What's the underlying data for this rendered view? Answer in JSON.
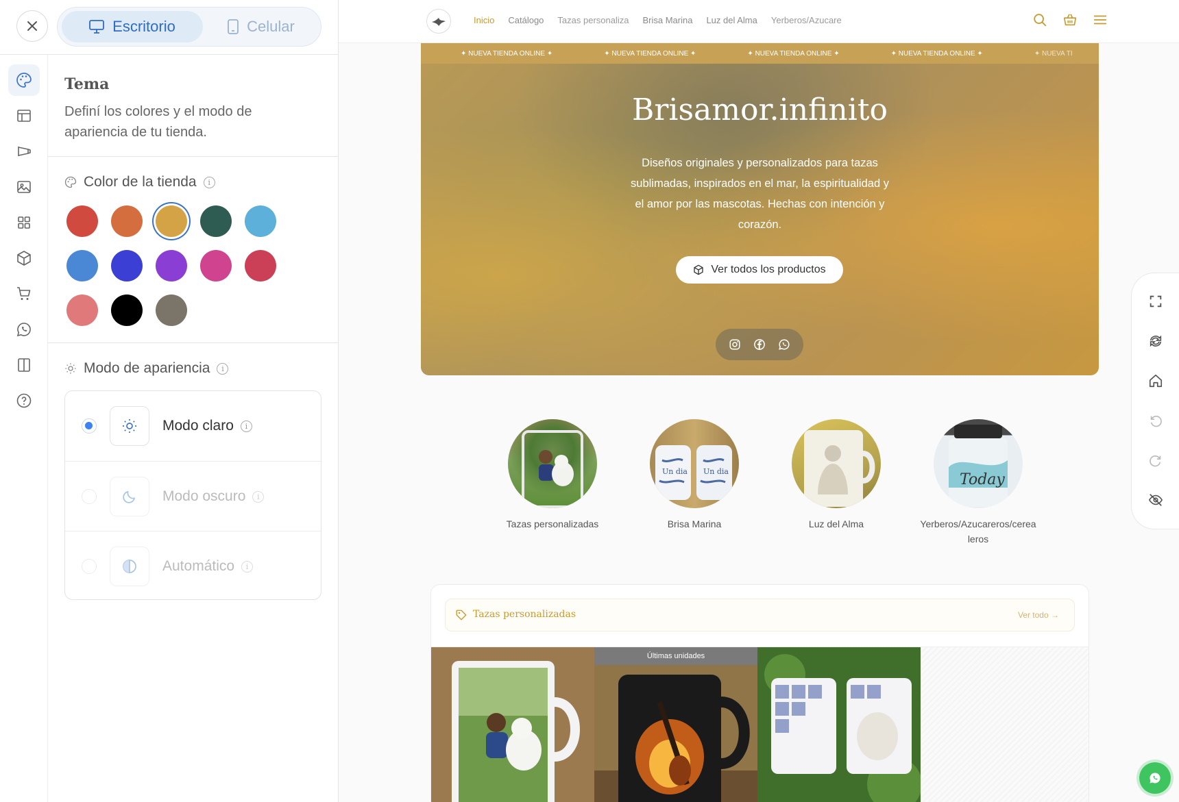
{
  "editor": {
    "view_toggle": {
      "desktop_label": "Escritorio",
      "mobile_label": "Celular",
      "active": "desktop"
    },
    "rail_icons": [
      "palette-icon",
      "layout-icon",
      "megaphone-icon",
      "image-icon",
      "grid-icon",
      "box-icon",
      "cart-icon",
      "whatsapp-icon",
      "columns-icon",
      "help-icon"
    ],
    "theme": {
      "title": "Tema",
      "description": "Definí los colores y el modo de apariencia de tu tienda."
    },
    "store_color": {
      "label": "Color de la tienda",
      "swatches": [
        "#d14a3f",
        "#d56e3e",
        "#d4a346",
        "#2f5c52",
        "#5cb0d9",
        "#4a88d6",
        "#3b3fd4",
        "#8a3ed4",
        "#d0448f",
        "#cc4057",
        "#e07a7a",
        "#000000",
        "#7b7468"
      ],
      "selected": "#d4a346"
    },
    "appearance": {
      "label": "Modo de apariencia",
      "modes": [
        {
          "label": "Modo claro",
          "icon": "sun-icon",
          "selected": true
        },
        {
          "label": "Modo oscuro",
          "icon": "moon-icon",
          "selected": false
        },
        {
          "label": "Automático",
          "icon": "half-circle-icon",
          "selected": false
        }
      ]
    }
  },
  "preview": {
    "nav": {
      "links": [
        "Inicio",
        "Catálogo",
        "Tazas personaliza",
        "Brisa Marina",
        "Luz del Alma",
        "Yerberos/Azucare"
      ],
      "active": "Inicio",
      "accent": "#c89a2e"
    },
    "ticker": [
      "✦ NUEVA TIENDA ONLINE ✦",
      "✦ NUEVA TIENDA ONLINE ✦",
      "✦ NUEVA TIENDA ONLINE ✦",
      "✦ NUEVA TIENDA ONLINE ✦",
      "✦ NUEVA TI"
    ],
    "hero": {
      "title": "Brisamor.infinito",
      "description": "Diseños originales y personalizados para tazas sublimadas, inspirados en el mar, la espiritualidad y el amor por las mascotas. Hechas con intención y corazón.",
      "button": "Ver todos los productos"
    },
    "categories": [
      {
        "label": "Tazas personalizadas"
      },
      {
        "label": "Brisa Marina"
      },
      {
        "label": "Luz del Alma"
      },
      {
        "label": "Yerberos/Azucareros/cerea leros"
      }
    ],
    "products_section": {
      "title": "Tazas personalizadas",
      "link": "Ver todo",
      "badge": "Últimas unidades"
    }
  }
}
